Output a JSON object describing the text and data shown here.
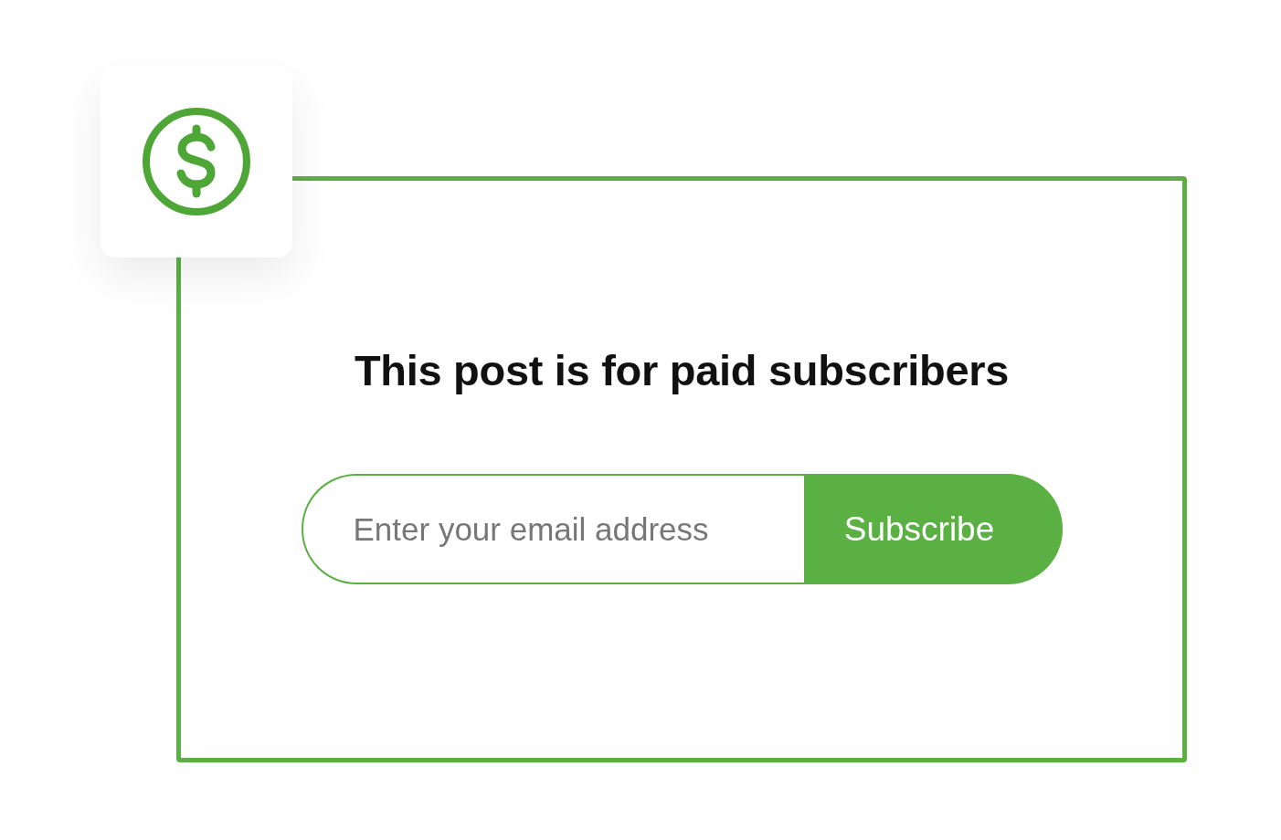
{
  "heading": "This post is for paid subscribers",
  "email_field": {
    "placeholder": "Enter your email address"
  },
  "subscribe_button": {
    "label": "Subscribe"
  }
}
